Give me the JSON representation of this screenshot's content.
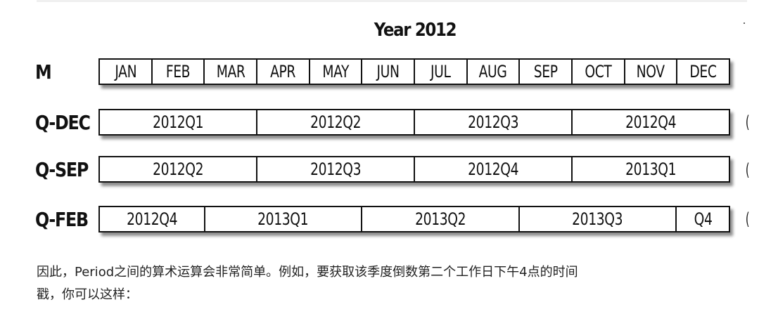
{
  "figure": {
    "title": "Year 2012",
    "rows": [
      {
        "label": "M",
        "cells": [
          "JAN",
          "FEB",
          "MAR",
          "APR",
          "MAY",
          "JUN",
          "JUL",
          "AUG",
          "SEP",
          "OCT",
          "NOV",
          "DEC"
        ],
        "spans": [
          1,
          1,
          1,
          1,
          1,
          1,
          1,
          1,
          1,
          1,
          1,
          1
        ],
        "offset": 0
      },
      {
        "label": "Q-DEC",
        "cells": [
          "2012Q1",
          "2012Q2",
          "2012Q3",
          "2012Q4"
        ],
        "spans": [
          3,
          3,
          3,
          3
        ],
        "offset": 0
      },
      {
        "label": "Q-SEP",
        "cells": [
          "2012Q2",
          "2012Q3",
          "2012Q4",
          "2013Q1"
        ],
        "spans": [
          3,
          3,
          3,
          3
        ],
        "offset": 0
      },
      {
        "label": "Q-FEB",
        "cells": [
          "2012Q4",
          "2013Q1",
          "2013Q2",
          "2013Q3",
          "Q4"
        ],
        "spans": [
          2,
          3,
          3,
          3,
          1
        ],
        "offset": 0
      }
    ]
  },
  "paragraph": {
    "line1": "因此，Period之间的算术运算会非常简单。例如，要获取该季度倒数第二个工作日下午4点的时间",
    "line2": "戳，你可以这样："
  }
}
